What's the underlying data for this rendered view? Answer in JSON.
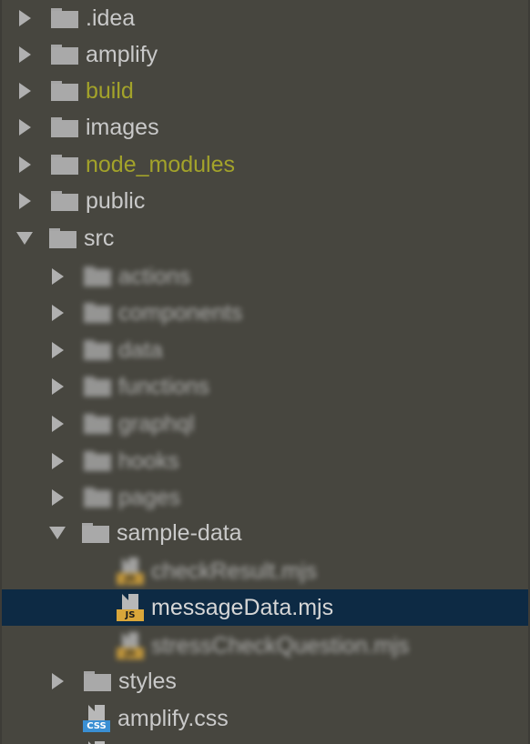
{
  "tree": {
    "root_items": [
      {
        "name": ".idea"
      },
      {
        "name": "amplify"
      },
      {
        "name": "build"
      },
      {
        "name": "images"
      },
      {
        "name": "node_modules"
      },
      {
        "name": "public"
      },
      {
        "name": "src"
      }
    ],
    "src_children": [
      {
        "name": "actions"
      },
      {
        "name": "components"
      },
      {
        "name": "data"
      },
      {
        "name": "functions"
      },
      {
        "name": "graphql"
      },
      {
        "name": "hooks"
      },
      {
        "name": "pages"
      },
      {
        "name": "sample-data"
      }
    ],
    "sample_data_files": [
      {
        "name": "checkResult.mjs",
        "type": "JS"
      },
      {
        "name": "messageData.mjs",
        "type": "JS"
      },
      {
        "name": "stressCheckQuestion.mjs",
        "type": "JS"
      }
    ],
    "tail_items": [
      {
        "name": "styles"
      },
      {
        "name": "amplify.css",
        "type": "CSS"
      }
    ]
  },
  "colors": {
    "background": "#47463f",
    "selection": "#0d2a44",
    "excluded_folder_text": "#a3a32a",
    "js_badge": "#d9a63a",
    "css_badge": "#3a8fd3"
  }
}
